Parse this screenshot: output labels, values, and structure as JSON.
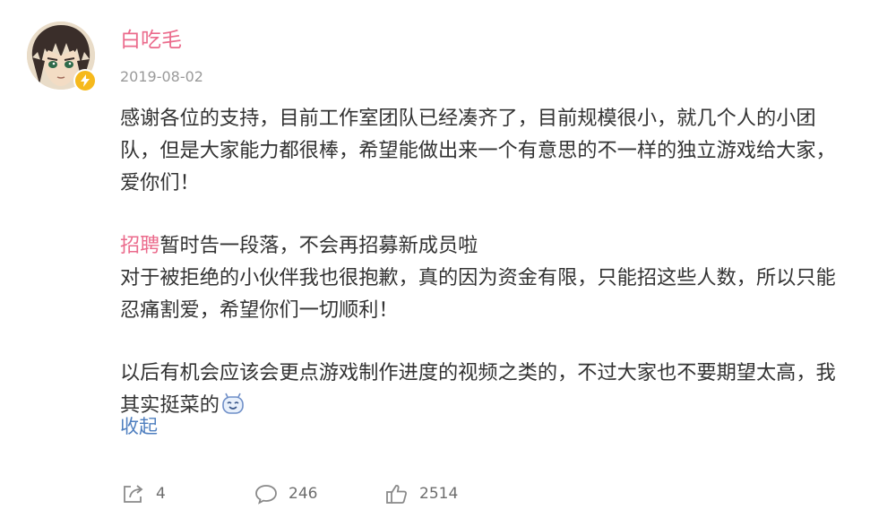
{
  "user": {
    "name": "白吃毛",
    "date": "2019-08-02",
    "avatar": "anime-character-avatar",
    "badge": "verified-badge-icon",
    "name_color": "#eb6b8c"
  },
  "post": {
    "paragraph1": {
      "line1": "感谢各位的支持，目前工作室团队已经凑齐了，目前规模很小，就几个人的小团",
      "line2": "队，但是大家能力都很棒，希望能做出来一个有意思的不一样的独立游戏给大家，",
      "line3": "爱你们！"
    },
    "paragraph2": {
      "topic": "招聘",
      "line1_rest": "暂时告一段落，不会再招募新成员啦",
      "line2": "对于被拒绝的小伙伴我也很抱歉，真的因为资金有限，只能招这些人数，所以只能",
      "line3": "忍痛割爱，希望你们一切顺利！"
    },
    "paragraph3": {
      "line1": "以后有机会应该会更点游戏制作进度的视频之类的，不过大家也不要期望太高，我",
      "line2": "其实挺菜的",
      "emoji": "smiling-face-emoji-icon"
    },
    "collapse_label": "收起",
    "link_color": "#4f7fbf"
  },
  "actions": {
    "repost": {
      "icon": "repost-icon",
      "count": "4"
    },
    "comment": {
      "icon": "comment-icon",
      "count": "246"
    },
    "like": {
      "icon": "thumbs-up-icon",
      "count": "2514"
    }
  }
}
